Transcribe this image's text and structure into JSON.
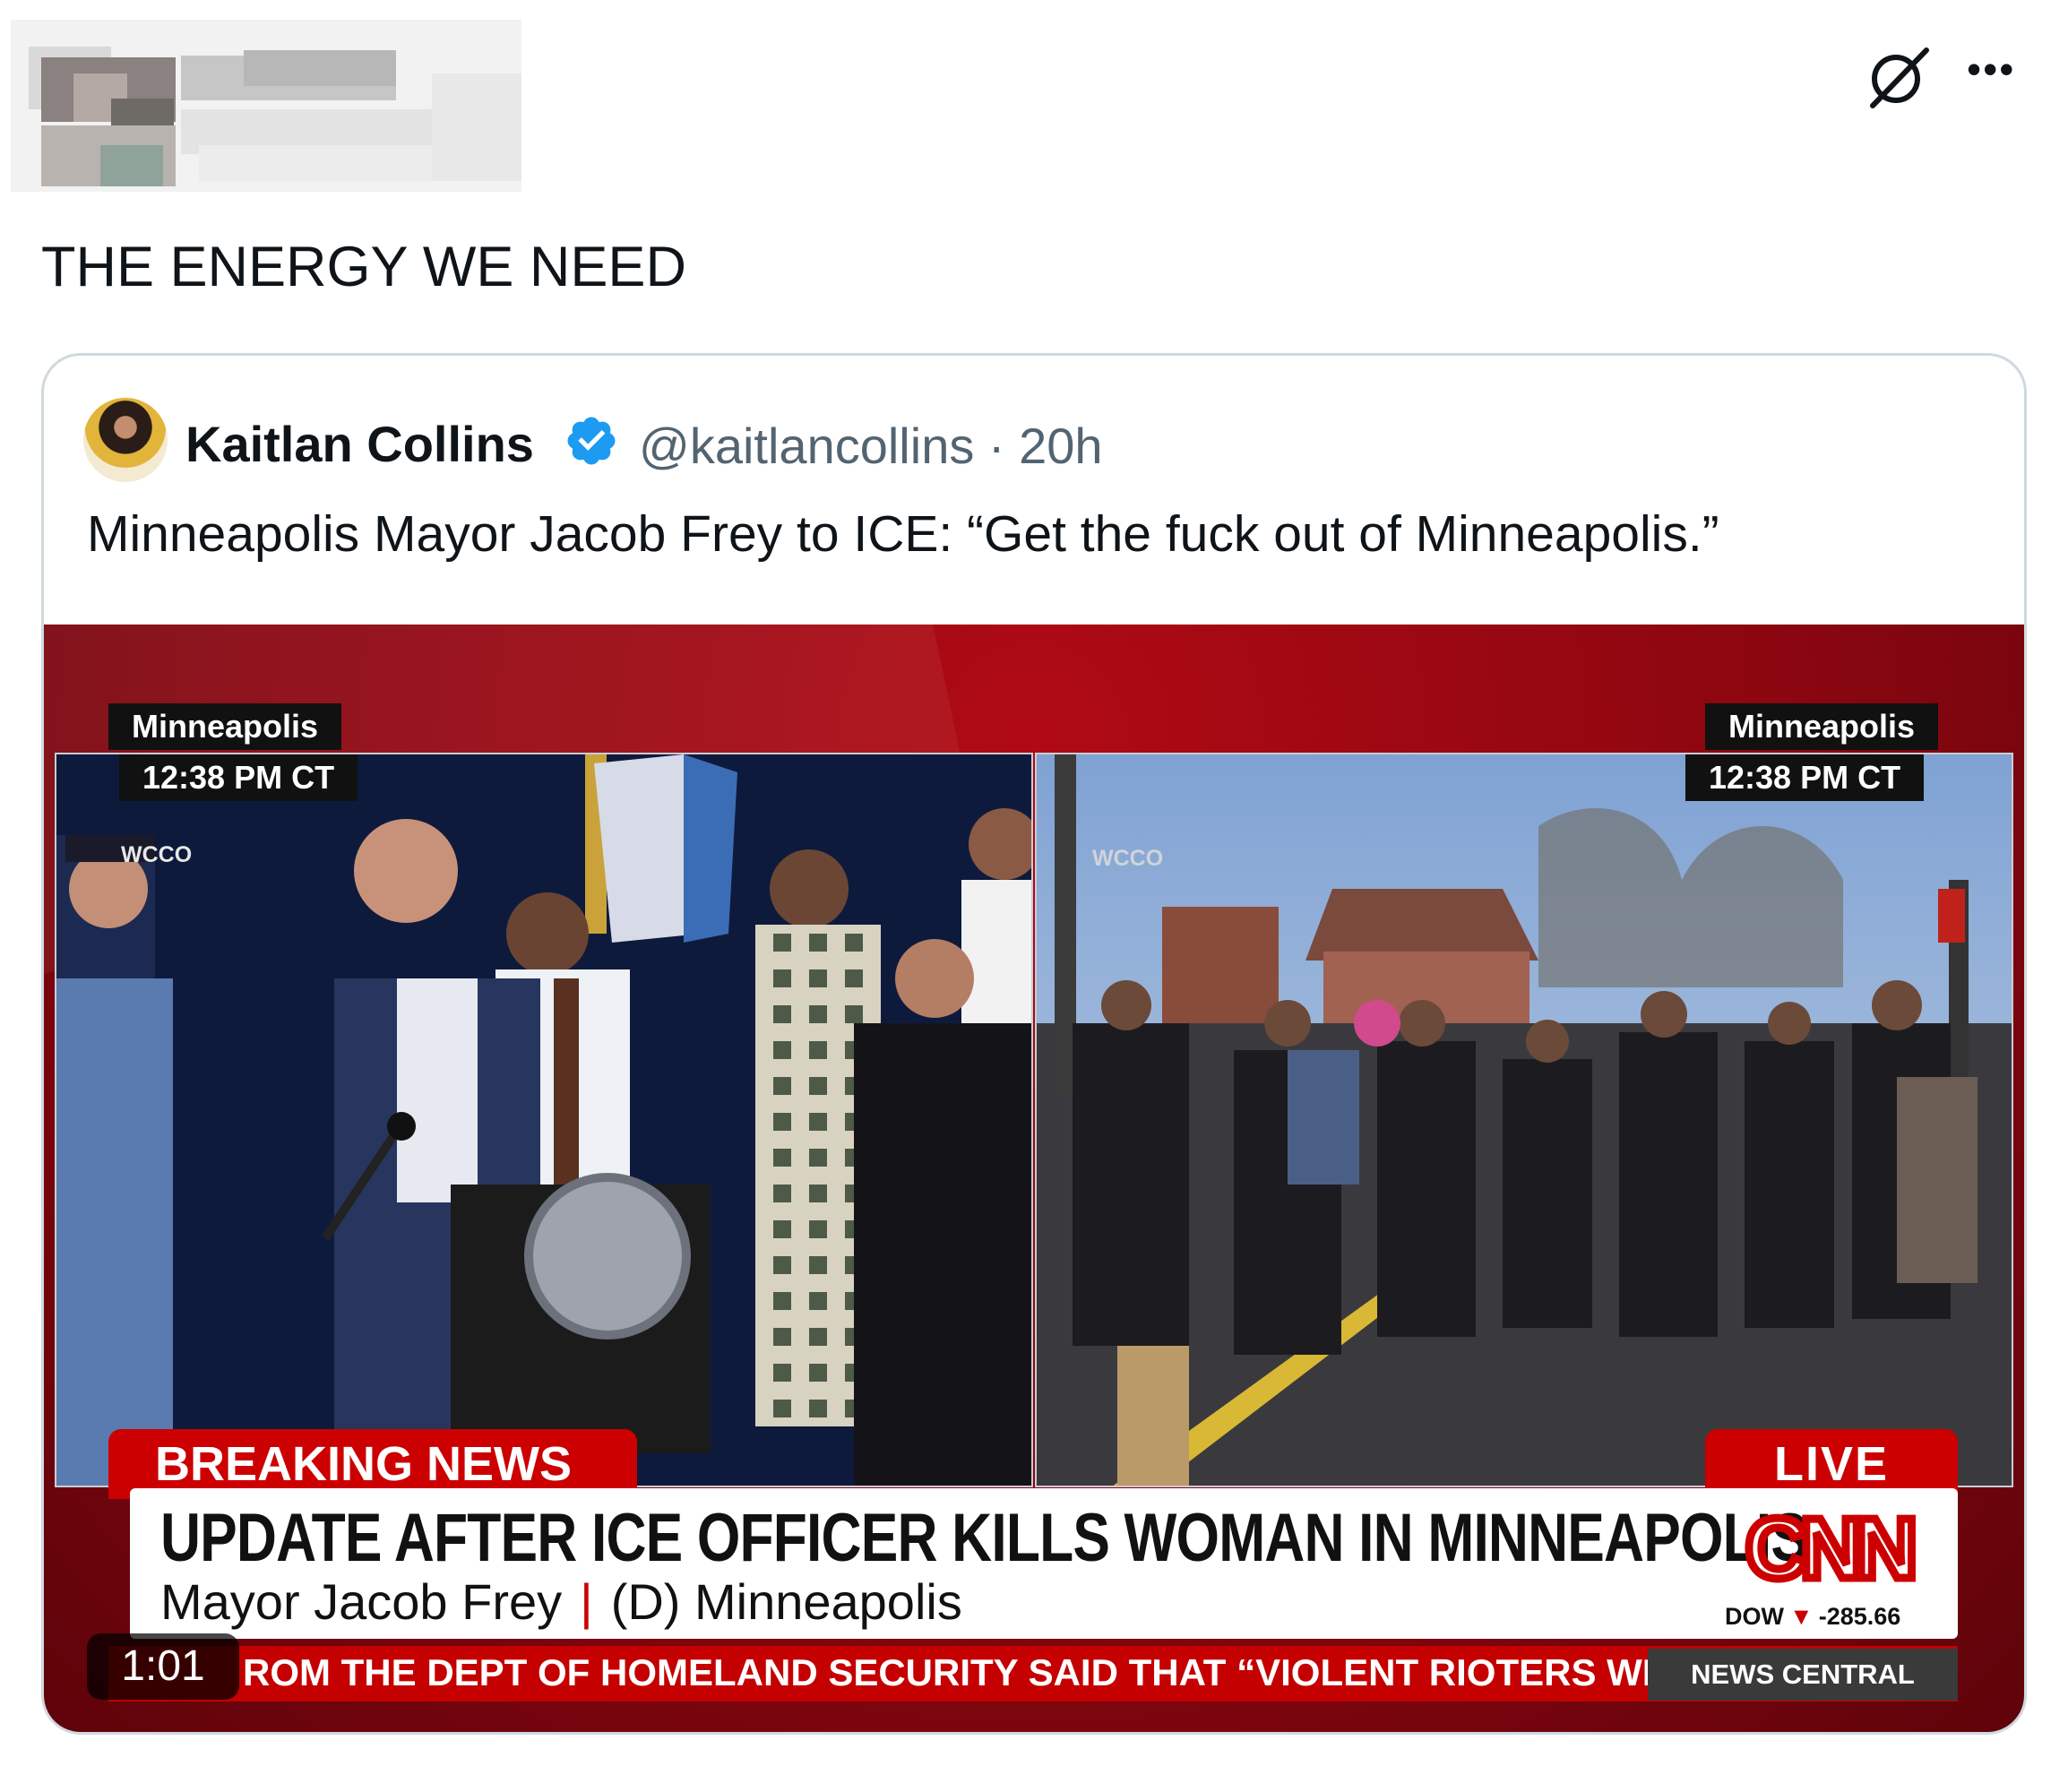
{
  "post": {
    "text": "THE ENERGY WE NEED"
  },
  "quoted_post": {
    "author_name": "Kaitlan Collins",
    "handle_time": "@kaitlancollins · 20h",
    "text": "Minneapolis Mayor Jacob Frey to ICE: “Get the fuck out of Minneapolis.”"
  },
  "video": {
    "left_location": "Minneapolis",
    "left_time": "12:38 PM CT",
    "right_location": "Minneapolis",
    "right_time": "12:38 PM CT",
    "left_watermark": "WCCO",
    "right_watermark": "WCCO",
    "breaking_label": "BREAKING NEWS",
    "live_label": "LIVE",
    "headline": "UPDATE AFTER ICE OFFICER KILLS WOMAN IN MINNEAPOLIS",
    "sub_name": "Mayor Jacob Frey",
    "sub_separator": "|",
    "sub_party": "(D) Minneapolis",
    "dow_label": "DOW",
    "dow_value": "-285.66",
    "ticker": "ROM THE DEPT OF HOMELAND SECURITY SAID THAT “VIOLENT RIOTERS WEAPONIZED” A",
    "news_central": "NEWS CENTRAL",
    "duration": "1:01",
    "cnn_logo_text": "CNN"
  },
  "icons": {
    "grok": "grok-icon",
    "more": "more-icon",
    "verified": "verified-badge-icon"
  },
  "colors": {
    "verified_blue": "#1d9bf0",
    "cnn_red": "#cc0000",
    "text_primary": "#0f1419",
    "text_secondary": "#536471",
    "card_border": "#cfd9de"
  }
}
